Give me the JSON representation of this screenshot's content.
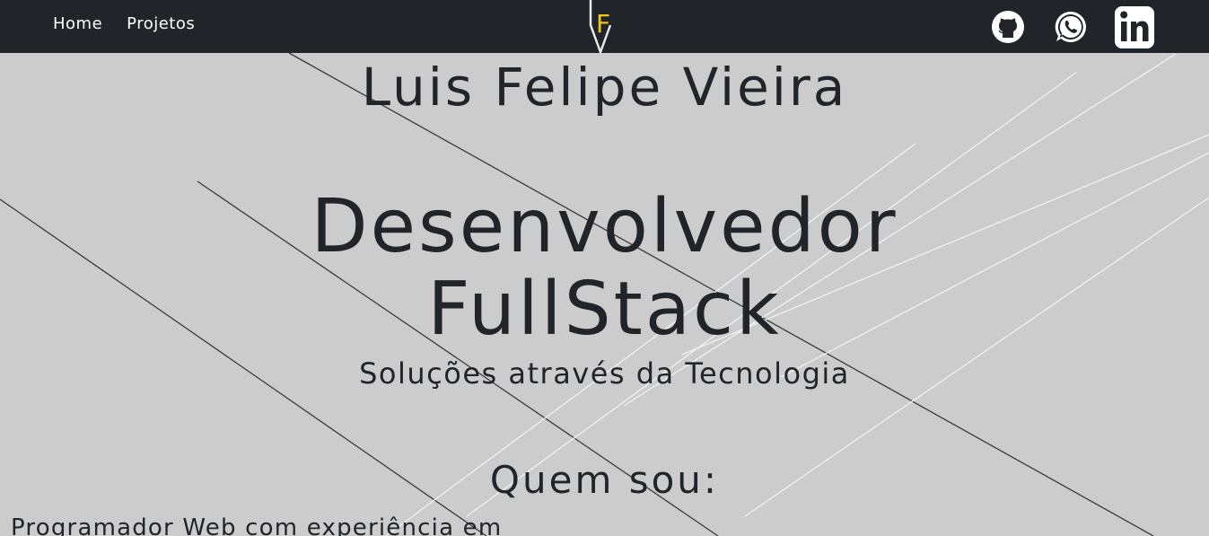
{
  "nav": {
    "links": [
      {
        "label": "Home"
      },
      {
        "label": "Projetos"
      }
    ],
    "logo_letter": "F",
    "social": [
      {
        "icon": "github-icon"
      },
      {
        "icon": "whatsapp-icon"
      },
      {
        "icon": "linkedin-icon"
      }
    ]
  },
  "hero": {
    "name": "Luis Felipe Vieira",
    "role_line1": "Desenvolvedor",
    "role_line2": "FullStack",
    "tagline": "Soluções através da Tecnologia"
  },
  "about": {
    "title": "Quem sou:",
    "text": "Programador Web com experiência em"
  },
  "colors": {
    "background": "#cccccc",
    "navbar": "#212429",
    "text": "#212429",
    "accent": "#f5c518",
    "nav_text": "#ffffff"
  }
}
